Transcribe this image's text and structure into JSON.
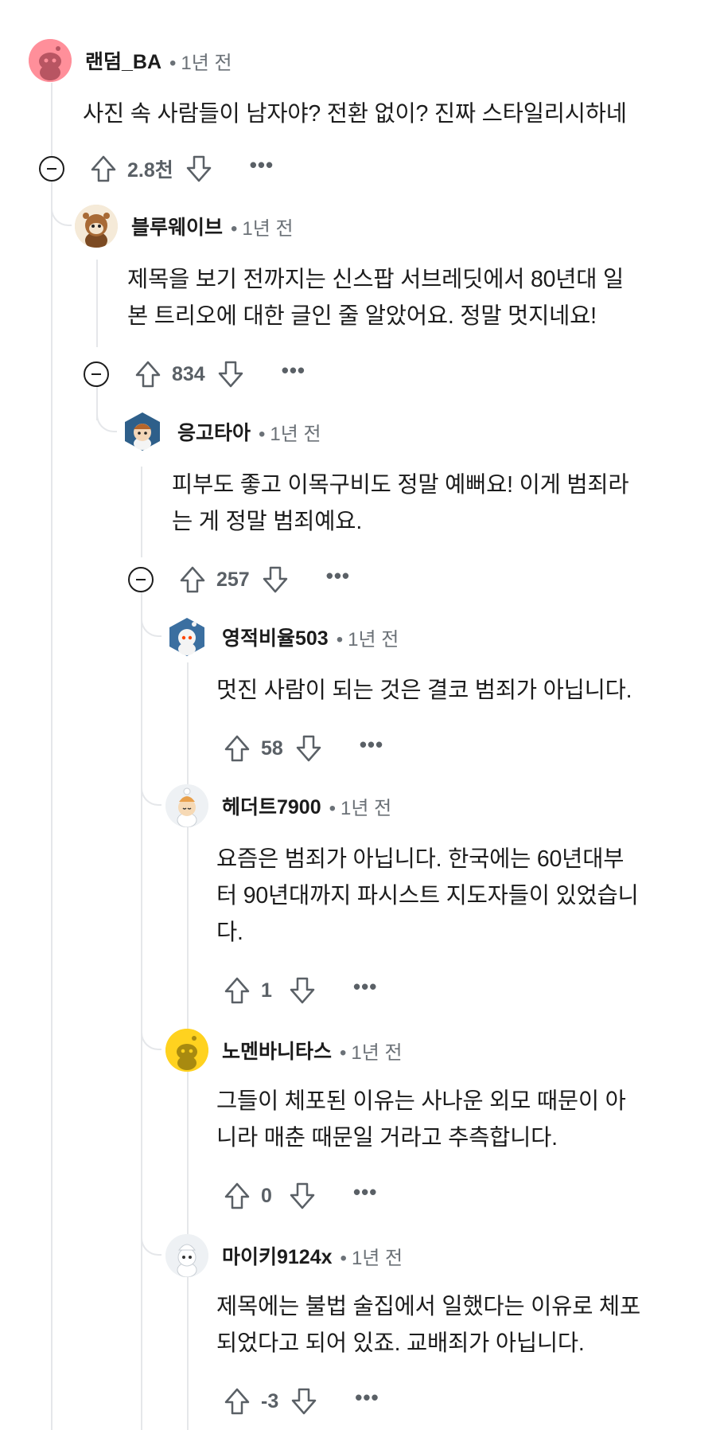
{
  "comments": [
    {
      "author": "랜덤_BA",
      "time": "1년 전",
      "text": "사진 속 사람들이 남자야? 전환 없이? 진짜 스타일리시하네",
      "score": "2.8천",
      "avatar_color": "#ff8f9a",
      "avatar_icon": "snoo-default-icon"
    },
    {
      "author": "블루웨이브",
      "time": "1년 전",
      "text": "제목을 보기 전까지는 신스팝 서브레딧에서 80년대 일\n본 트리오에 대한 글인 줄 알았어요. 정말 멋지네요!",
      "score": "834",
      "avatar_color": "#f1e2c9",
      "avatar_icon": "snoo-costume-icon"
    },
    {
      "author": "응고타아",
      "time": "1년 전",
      "text": "피부도 좋고 이목구비도 정말 예뻐요! 이게 범죄라\n는 게 정말 범죄예요.",
      "score": "257",
      "avatar_color": "#2e5f8a",
      "avatar_icon": "snoo-hexagon-icon"
    },
    {
      "author": "영적비율503",
      "time": "1년 전",
      "text": "멋진 사람이 되는 것은 결코 범죄가 아닙니다.",
      "score": "58",
      "avatar_color": "#3b6fa0",
      "avatar_icon": "snoo-hexagon-icon"
    },
    {
      "author": "헤더트7900",
      "time": "1년 전",
      "text": "요즘은 범죄가 아닙니다. 한국에는 60년대부\n터 90년대까지 파시스트 지도자들이 있었습니\n다.",
      "score": "1",
      "avatar_color": "#eef1f4",
      "avatar_icon": "snoo-chef-icon"
    },
    {
      "author": "노멘바니타스",
      "time": "1년 전",
      "text": "그들이 체포된 이유는 사나운 외모 때문이 아\n니라 매춘 때문일 거라고 추측합니다.",
      "score": "0",
      "avatar_color": "#ffd21f",
      "avatar_icon": "snoo-default-icon"
    },
    {
      "author": "마이키9124x",
      "time": "1년 전",
      "text": "제목에는 불법 술집에서 일했다는 이유로 체포\n되었다고 되어 있죠. 교배죄가 아닙니다.",
      "score": "-3",
      "avatar_color": "#eef1f4",
      "avatar_icon": "snoo-chef-icon"
    }
  ],
  "ui": {
    "separator": "•",
    "more_label": "•••"
  }
}
